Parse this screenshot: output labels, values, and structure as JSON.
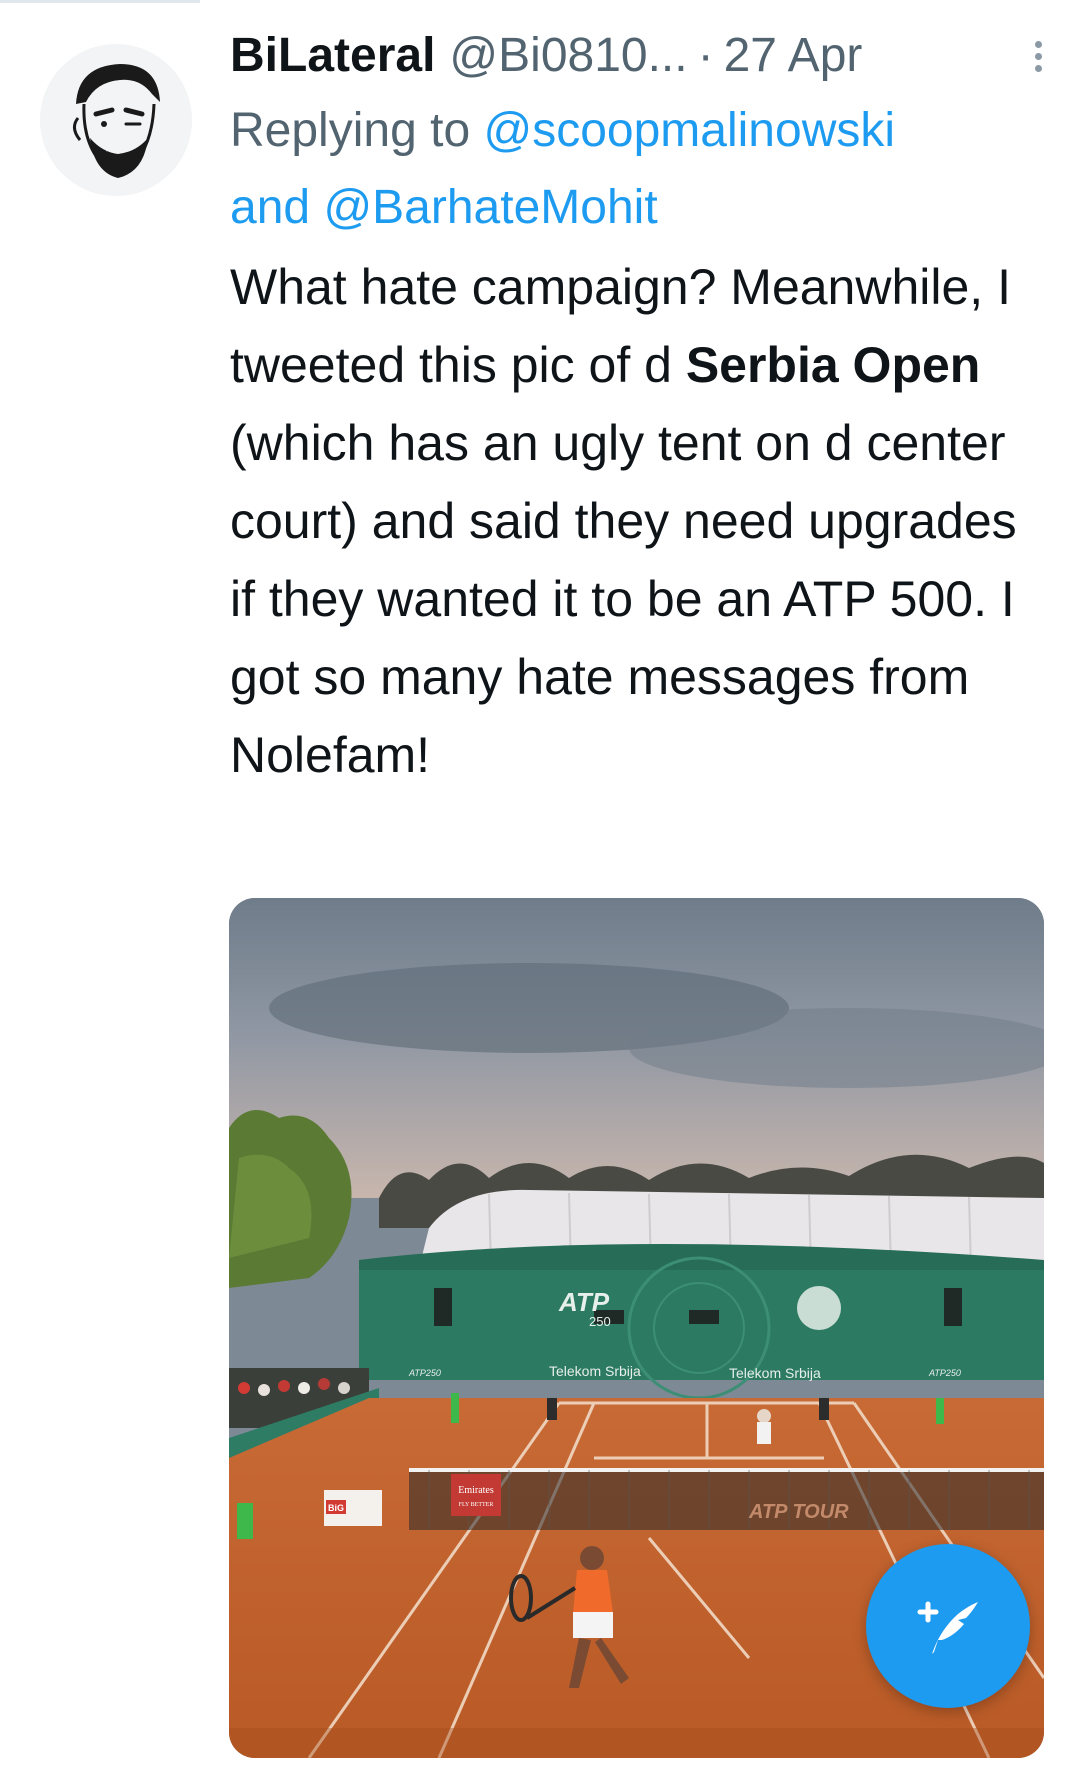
{
  "tweet": {
    "display_name": "BiLateral",
    "handle": "@Bi0810...",
    "separator": "·",
    "date": "27 Apr",
    "replying_prefix": "Replying to",
    "mention_1": "@scoopmalinowski",
    "conjunction": "and",
    "mention_2": "@BarhateMohit",
    "text_part_1": "What hate campaign? Meanwhile, I tweeted this pic of d ",
    "text_bold": "Serbia Open",
    "text_part_2": " (which has an ugly tent on d center court) and said they need upgrades if they wanted it to be an ATP 500. I got so many hate messages from Nolefam!"
  },
  "media": {
    "banner_atp": "ATP",
    "banner_atp_tier": "250",
    "banner_sponsor_1": "Telekom Srbija",
    "banner_sponsor_2": "Telekom Srbija",
    "net_sponsor": "Emirates",
    "net_tagline": "FLY BETTER",
    "court_text": "ATP TOUR",
    "small_board": "BiG",
    "left_tag": "ATP250",
    "right_tag": "ATP250"
  },
  "colors": {
    "accent": "#1d9bf0",
    "clay": "#c9662f",
    "wall": "#2d7a63"
  },
  "icons": {
    "more": "more-vertical-icon",
    "compose": "compose-tweet-icon"
  }
}
